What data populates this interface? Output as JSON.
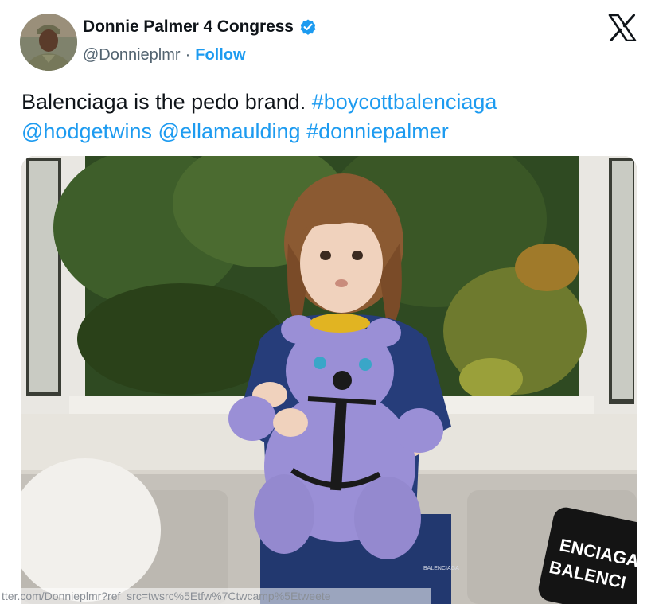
{
  "author": {
    "display_name": "Donnie Palmer 4 Congress",
    "handle": "@Donnieplmr",
    "separator": "·",
    "follow_label": "Follow",
    "verified": true
  },
  "tweet": {
    "text_plain": "Balenciaga is the pedo brand. ",
    "hashtag_1": "#boycottbalenciaga",
    "mention_1": "@hodgetwins",
    "mention_2": "@ellamaulding",
    "hashtag_2": "#donniepalmer"
  },
  "media": {
    "pillow_text_1": "ENCIAGA",
    "pillow_text_2": "BALENCI",
    "shorts_text": "BALENCIAGA"
  },
  "status_bar": {
    "url": "tter.com/Donnieplmr?ref_src=twsrc%5Etfw%7Ctwcamp%5Etweete"
  },
  "colors": {
    "accent": "#1d9bf0",
    "text": "#0f1419",
    "secondary": "#536471"
  }
}
